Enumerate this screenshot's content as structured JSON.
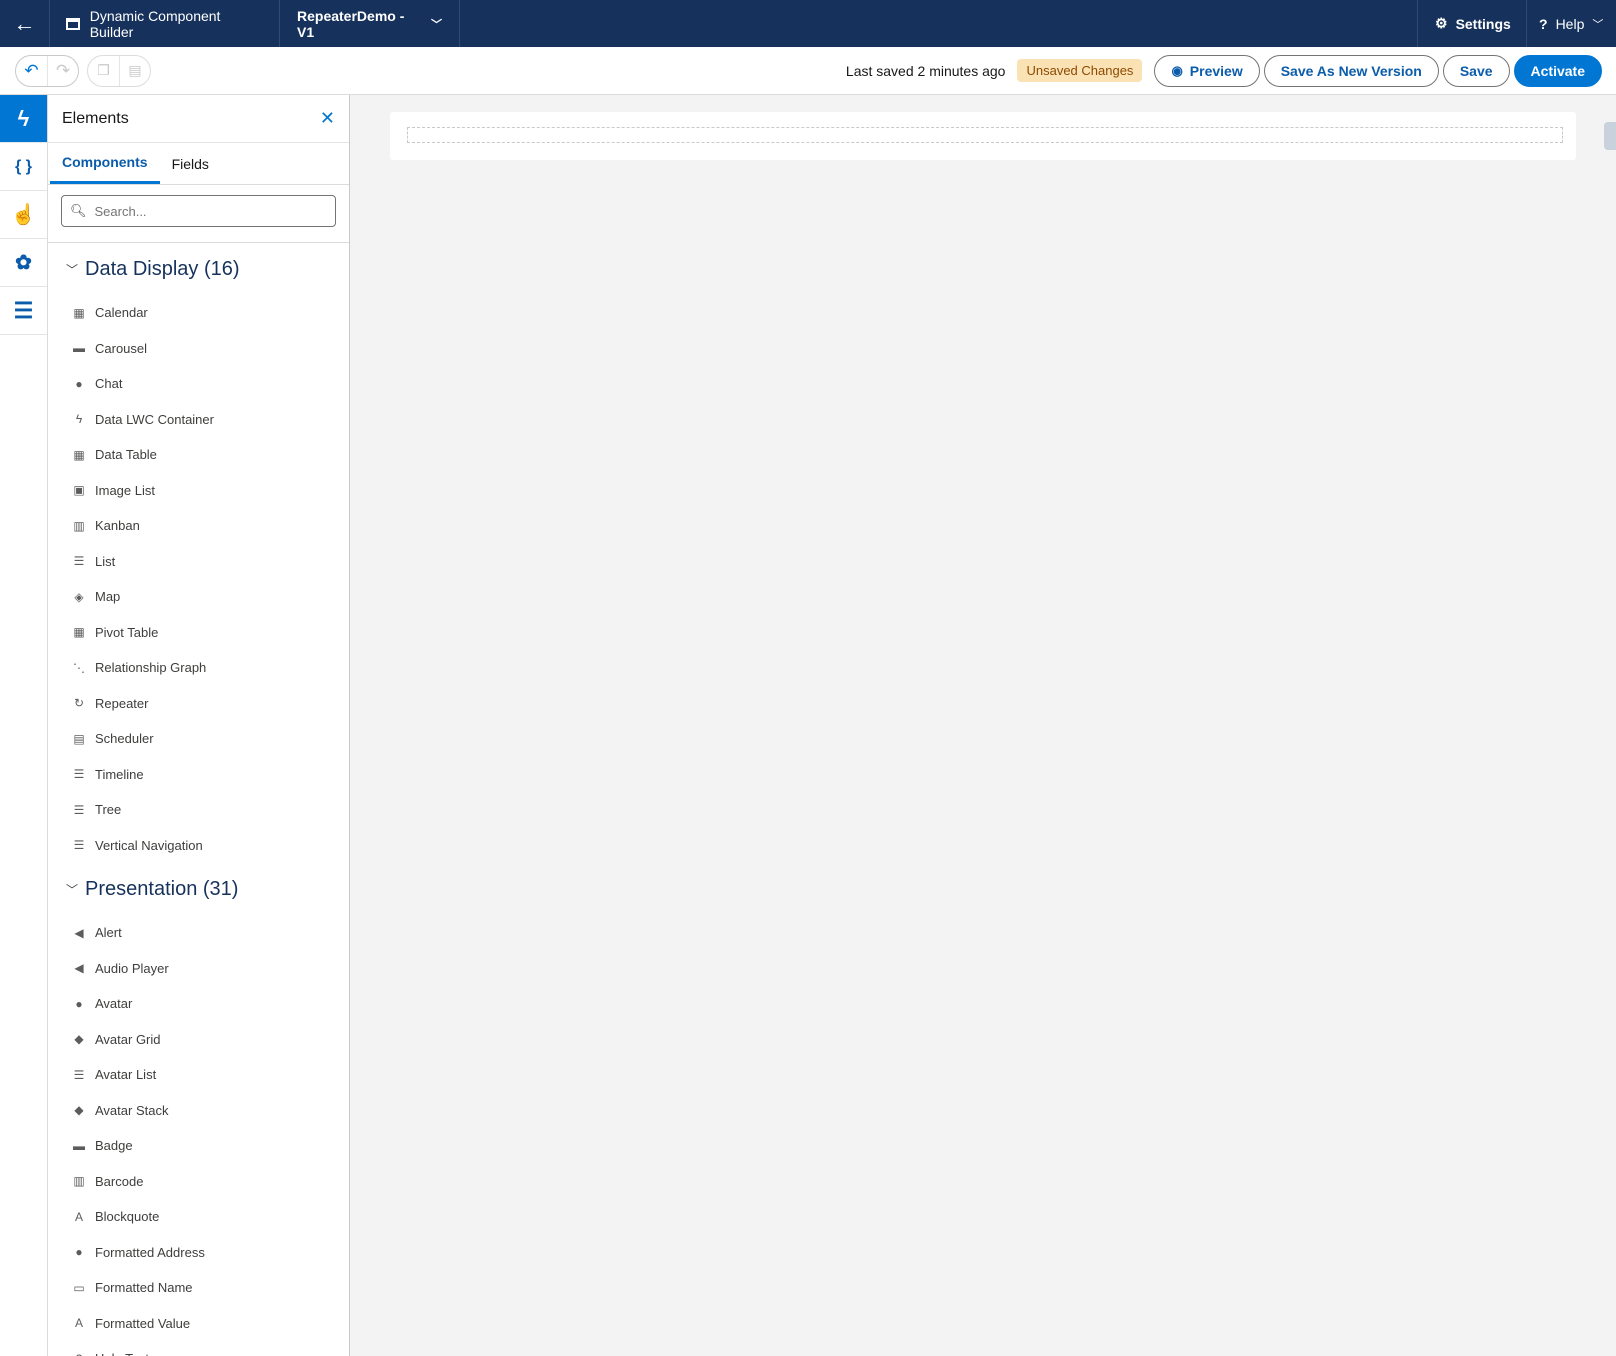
{
  "topbar": {
    "app_title": "Dynamic Component Builder",
    "version": "RepeaterDemo - V1",
    "settings": "Settings",
    "help": "Help"
  },
  "toolbar": {
    "last_saved": "Last saved 2 minutes ago",
    "unsaved": "Unsaved Changes",
    "preview": "Preview",
    "save_as_new": "Save As New Version",
    "save": "Save",
    "activate": "Activate"
  },
  "panel": {
    "title": "Elements",
    "tabs": [
      "Components",
      "Fields"
    ],
    "search_placeholder": "Search..."
  },
  "sections": [
    {
      "title": "Data Display (16)",
      "items": [
        {
          "label": "Calendar",
          "icon": "calendar-icon"
        },
        {
          "label": "Carousel",
          "icon": "carousel-icon"
        },
        {
          "label": "Chat",
          "icon": "chat-icon"
        },
        {
          "label": "Data LWC Container",
          "icon": "bolt-icon"
        },
        {
          "label": "Data Table",
          "icon": "table-icon"
        },
        {
          "label": "Image List",
          "icon": "image-icon"
        },
        {
          "label": "Kanban",
          "icon": "kanban-icon"
        },
        {
          "label": "List",
          "icon": "list-icon"
        },
        {
          "label": "Map",
          "icon": "map-icon"
        },
        {
          "label": "Pivot Table",
          "icon": "table-icon"
        },
        {
          "label": "Relationship Graph",
          "icon": "graph-icon"
        },
        {
          "label": "Repeater",
          "icon": "refresh-icon"
        },
        {
          "label": "Scheduler",
          "icon": "scheduler-icon"
        },
        {
          "label": "Timeline",
          "icon": "list-icon"
        },
        {
          "label": "Tree",
          "icon": "tree-icon"
        },
        {
          "label": "Vertical Navigation",
          "icon": "list-icon"
        }
      ]
    },
    {
      "title": "Presentation (31)",
      "items": [
        {
          "label": "Alert",
          "icon": "alert-icon"
        },
        {
          "label": "Audio Player",
          "icon": "speaker-icon"
        },
        {
          "label": "Avatar",
          "icon": "user-icon"
        },
        {
          "label": "Avatar Grid",
          "icon": "users-icon"
        },
        {
          "label": "Avatar List",
          "icon": "list-icon"
        },
        {
          "label": "Avatar Stack",
          "icon": "stack-icon"
        },
        {
          "label": "Badge",
          "icon": "badge-icon"
        },
        {
          "label": "Barcode",
          "icon": "barcode-icon"
        },
        {
          "label": "Blockquote",
          "icon": "text-case-icon"
        },
        {
          "label": "Formatted Address",
          "icon": "location-icon"
        },
        {
          "label": "Formatted Name",
          "icon": "contact-card-icon"
        },
        {
          "label": "Formatted Value",
          "icon": "letter-a-icon"
        },
        {
          "label": "Help Text",
          "icon": "help-icon"
        }
      ]
    }
  ]
}
